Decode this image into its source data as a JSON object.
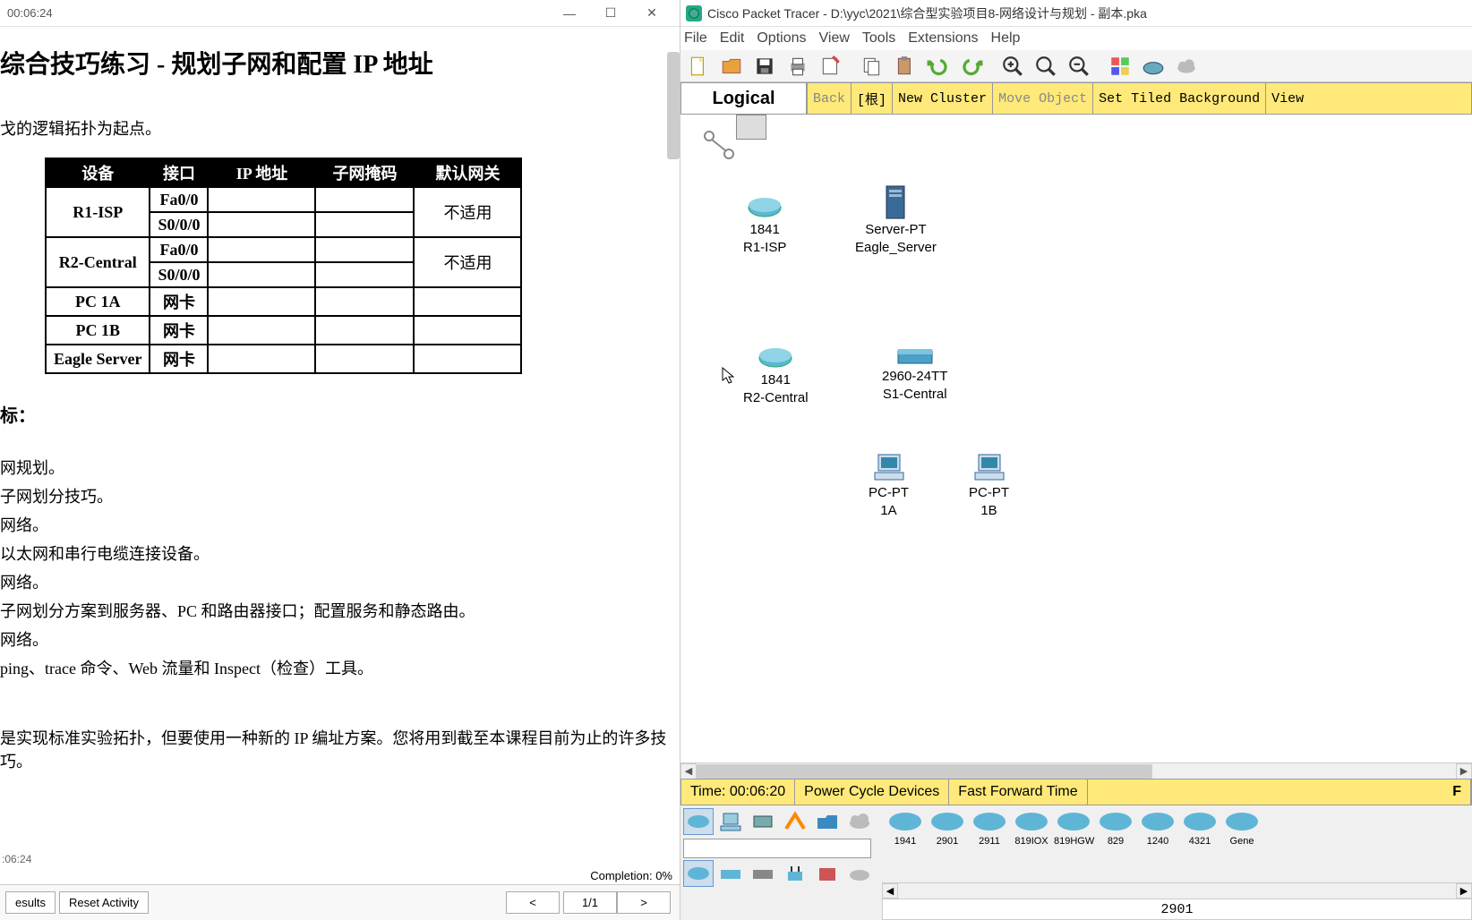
{
  "left": {
    "title_time": "00:06:24",
    "heading": "综合技巧练习 - 规划子网和配置 IP 地址",
    "intro_line": "戈的逻辑拓扑为起点。",
    "table": {
      "headers": [
        "设备",
        "接口",
        "IP 地址",
        "子网掩码",
        "默认网关"
      ],
      "rows": [
        {
          "device": "R1-ISP",
          "iface": "Fa0/0",
          "ip": "",
          "mask": "",
          "gw": "不适用",
          "gw_rowspan": 2
        },
        {
          "device": "",
          "iface": "S0/0/0",
          "ip": "",
          "mask": "",
          "gw": ""
        },
        {
          "device": "R2-Central",
          "iface": "Fa0/0",
          "ip": "",
          "mask": "",
          "gw": "不适用",
          "gw_rowspan": 2
        },
        {
          "device": "",
          "iface": "S0/0/0",
          "ip": "",
          "mask": "",
          "gw": ""
        },
        {
          "device": "PC 1A",
          "iface": "网卡",
          "ip": "",
          "mask": "",
          "gw": ""
        },
        {
          "device": "PC 1B",
          "iface": "网卡",
          "ip": "",
          "mask": "",
          "gw": ""
        },
        {
          "device": "Eagle Server",
          "iface": "网卡",
          "ip": "",
          "mask": "",
          "gw": ""
        }
      ]
    },
    "section_heading": "标：",
    "bullets": [
      "网规划。",
      "子网划分技巧。",
      "网络。",
      "以太网和串行电缆连接设备。",
      "网络。",
      "子网划分方案到服务器、PC 和路由器接口；配置服务和静态路由。",
      "网络。",
      " ping、trace 命令、Web 流量和 Inspect（检查）工具。"
    ],
    "bottom_para": "是实现标准实验拓扑，但要使用一种新的 IP 编址方案。您将用到截至本课程目前为止的许多技巧。",
    "timer_small": ":06:24",
    "completion": "Completion: 0%",
    "results_btn": "esults",
    "reset_btn": "Reset Activity",
    "prev_btn": "<",
    "next_btn": ">",
    "page": "1/1"
  },
  "right": {
    "app_title": "Cisco Packet Tracer - D:\\yyc\\2021\\综合型实验项目8-网络设计与规划 - 副本.pka",
    "menus": [
      "File",
      "Edit",
      "Options",
      "View",
      "Tools",
      "Extensions",
      "Help"
    ],
    "viewbar": {
      "logical": "Logical",
      "back": "Back",
      "root": "[根]",
      "new_cluster": "New Cluster",
      "move_object": "Move Object",
      "set_bg": "Set Tiled Background",
      "viewport": "View"
    },
    "devices": {
      "r1": {
        "line1": "1841",
        "line2": "R1-ISP"
      },
      "server": {
        "line1": "Server-PT",
        "line2": "Eagle_Server"
      },
      "r2": {
        "line1": "1841",
        "line2": "R2-Central"
      },
      "sw": {
        "line1": "2960-24TT",
        "line2": "S1-Central"
      },
      "pc1a": {
        "line1": "PC-PT",
        "line2": "1A"
      },
      "pc1b": {
        "line1": "PC-PT",
        "line2": "1B"
      }
    },
    "rt": {
      "time": "Time: 00:06:20",
      "pcd": "Power Cycle Devices",
      "fft": "Fast Forward Time"
    },
    "devlist": [
      "1941",
      "2901",
      "2911",
      "819IOX",
      "819HGW",
      "829",
      "1240",
      "4321",
      "Gene"
    ],
    "selected_device": "2901"
  }
}
